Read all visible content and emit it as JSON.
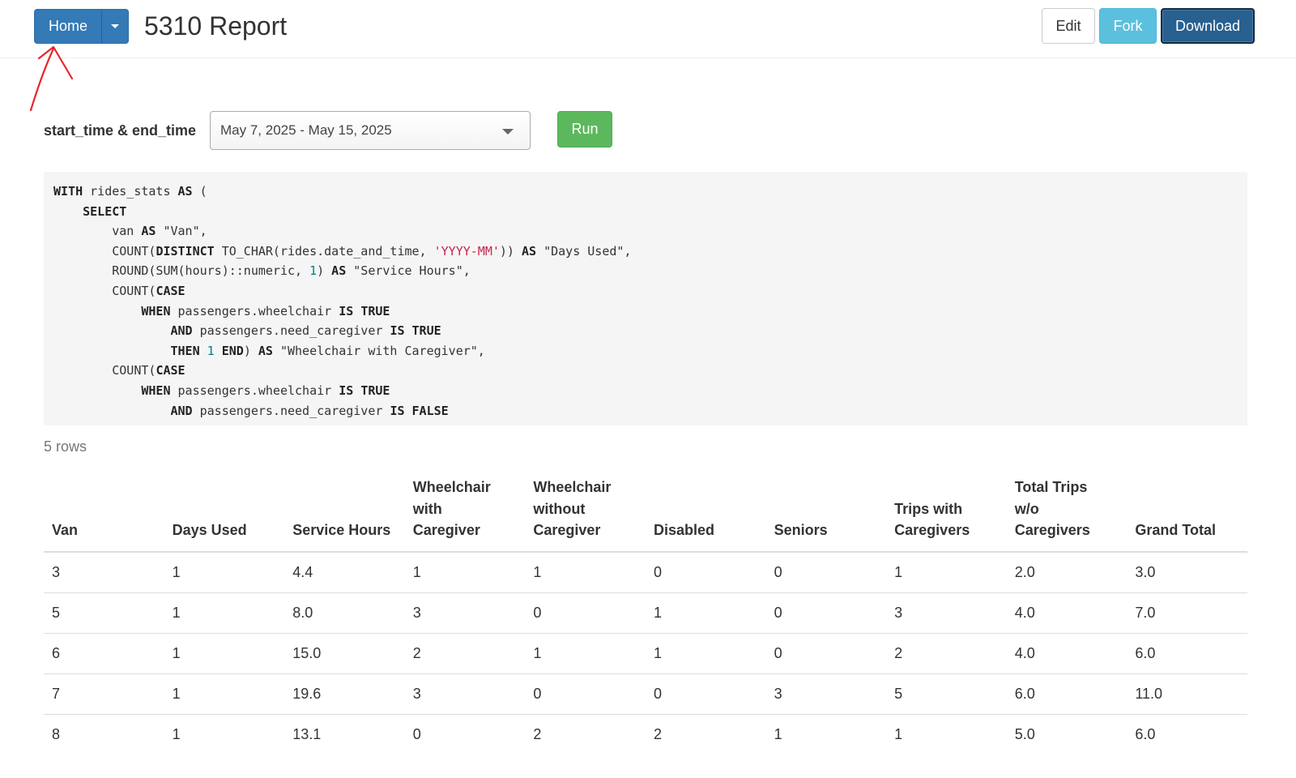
{
  "header": {
    "home_label": "Home",
    "title": "5310 Report",
    "edit_label": "Edit",
    "fork_label": "Fork",
    "download_label": "Download"
  },
  "parameters": {
    "label": "start_time & end_time",
    "date_range": "May 7, 2025 - May 15, 2025",
    "run_label": "Run"
  },
  "sql_lines": [
    "WITH rides_stats AS (",
    "    SELECT",
    "        van AS \"Van\",",
    "        COUNT(DISTINCT TO_CHAR(rides.date_and_time, 'YYYY-MM')) AS \"Days Used\",",
    "        ROUND(SUM(hours)::numeric, 1) AS \"Service Hours\",",
    "        COUNT(CASE",
    "            WHEN passengers.wheelchair IS TRUE",
    "                AND passengers.need_caregiver IS TRUE",
    "                THEN 1 END) AS \"Wheelchair with Caregiver\",",
    "        COUNT(CASE",
    "            WHEN passengers.wheelchair IS TRUE",
    "                AND passengers.need_caregiver IS FALSE"
  ],
  "results": {
    "row_count": "5 rows",
    "columns": [
      [
        "Van"
      ],
      [
        "Days Used"
      ],
      [
        "Service Hours"
      ],
      [
        "Wheelchair",
        "with",
        "Caregiver"
      ],
      [
        "Wheelchair",
        "without",
        "Caregiver"
      ],
      [
        "Disabled"
      ],
      [
        "Seniors"
      ],
      [
        "Trips with",
        "Caregivers"
      ],
      [
        "Total Trips",
        "w/o",
        "Caregivers"
      ],
      [
        "Grand Total"
      ]
    ],
    "rows": [
      [
        "3",
        "1",
        "4.4",
        "1",
        "1",
        "0",
        "0",
        "1",
        "2.0",
        "3.0"
      ],
      [
        "5",
        "1",
        "8.0",
        "3",
        "0",
        "1",
        "0",
        "3",
        "4.0",
        "7.0"
      ],
      [
        "6",
        "1",
        "15.0",
        "2",
        "1",
        "1",
        "0",
        "2",
        "4.0",
        "6.0"
      ],
      [
        "7",
        "1",
        "19.6",
        "3",
        "0",
        "0",
        "3",
        "5",
        "6.0",
        "11.0"
      ],
      [
        "8",
        "1",
        "13.1",
        "0",
        "2",
        "2",
        "1",
        "1",
        "5.0",
        "6.0"
      ]
    ]
  },
  "colors": {
    "home": "#337ab7",
    "fork": "#5bc0de",
    "download": "#286090",
    "run": "#5cb85c",
    "annotation": "#e8262a"
  }
}
